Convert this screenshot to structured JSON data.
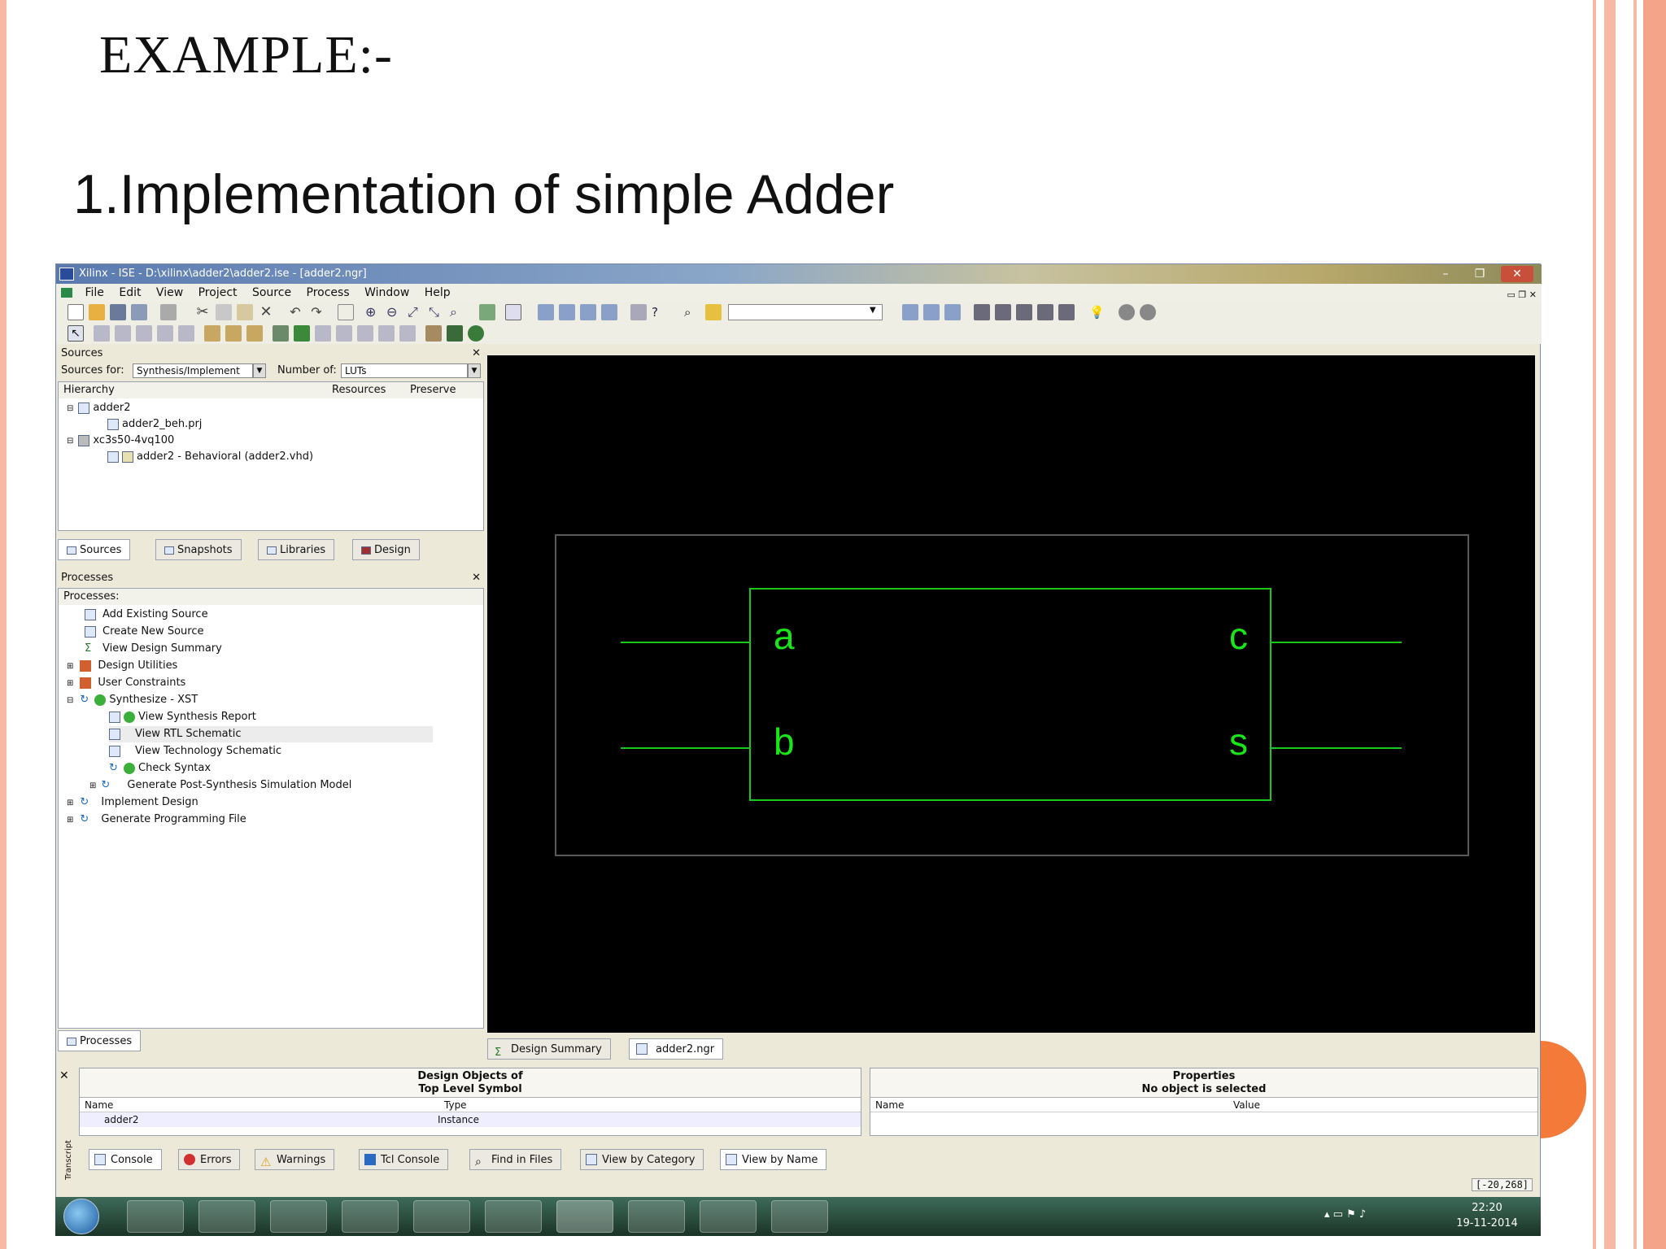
{
  "slide": {
    "title": "EXAMPLE:-",
    "subtitle": "1.Implementation of simple Adder",
    "accent_color": "#f47a3a",
    "border_colors": [
      "#f7b9a3",
      "#f4a488"
    ]
  },
  "window": {
    "title": "Xilinx - ISE - D:\\xilinx\\adder2\\adder2.ise - [adder2.ngr]",
    "controls": [
      "–",
      "❐",
      "✕"
    ],
    "menu": [
      "File",
      "Edit",
      "View",
      "Project",
      "Source",
      "Process",
      "Window",
      "Help"
    ]
  },
  "sources_panel": {
    "title": "Sources",
    "close": "✕",
    "sources_for_label": "Sources for:",
    "sources_for_value": "Synthesis/Implement",
    "number_of_label": "Number of:",
    "number_of_value": "LUTs",
    "col_hierarchy": "Hierarchy",
    "col_resources": "Resources",
    "col_preserve": "Preserve",
    "tree": [
      "adder2",
      "adder2_beh.prj",
      "xc3s50-4vq100",
      "adder2 - Behavioral (adder2.vhd)"
    ],
    "tabs": [
      "Sources",
      "Snapshots",
      "Libraries",
      "Design"
    ]
  },
  "processes_panel": {
    "title": "Processes",
    "close": "✕",
    "header": "Processes:",
    "items": [
      "Add Existing Source",
      "Create New Source",
      "View Design Summary",
      "Design Utilities",
      "User Constraints",
      "Synthesize - XST",
      "View Synthesis Report",
      "View RTL Schematic",
      "View Technology Schematic",
      "Check Syntax",
      "Generate Post-Synthesis Simulation Model",
      "Implement Design",
      "Generate Programming File"
    ],
    "tab": "Processes"
  },
  "schematic": {
    "inputs": [
      "a",
      "b"
    ],
    "outputs": [
      "c",
      "s"
    ],
    "wire_color": "#19c819"
  },
  "doc_tabs": [
    "Design Summary",
    "adder2.ngr"
  ],
  "design_objects": {
    "close": "✕",
    "title_line1": "Design Objects of",
    "title_line2": "Top Level Symbol",
    "col_name": "Name",
    "col_type": "Type",
    "row_name": "adder2",
    "row_type": "Instance"
  },
  "properties": {
    "title_line1": "Properties",
    "title_line2": "No object is selected",
    "col_name": "Name",
    "col_value": "Value"
  },
  "transcript_label": "Transcript",
  "bottom_tabs": [
    "Console",
    "Errors",
    "Warnings",
    "Tcl Console",
    "Find in Files",
    "View by Category",
    "View by Name"
  ],
  "status_coords": "[-20,268]",
  "taskbar": {
    "time": "22:20",
    "date": "19-11-2014"
  }
}
